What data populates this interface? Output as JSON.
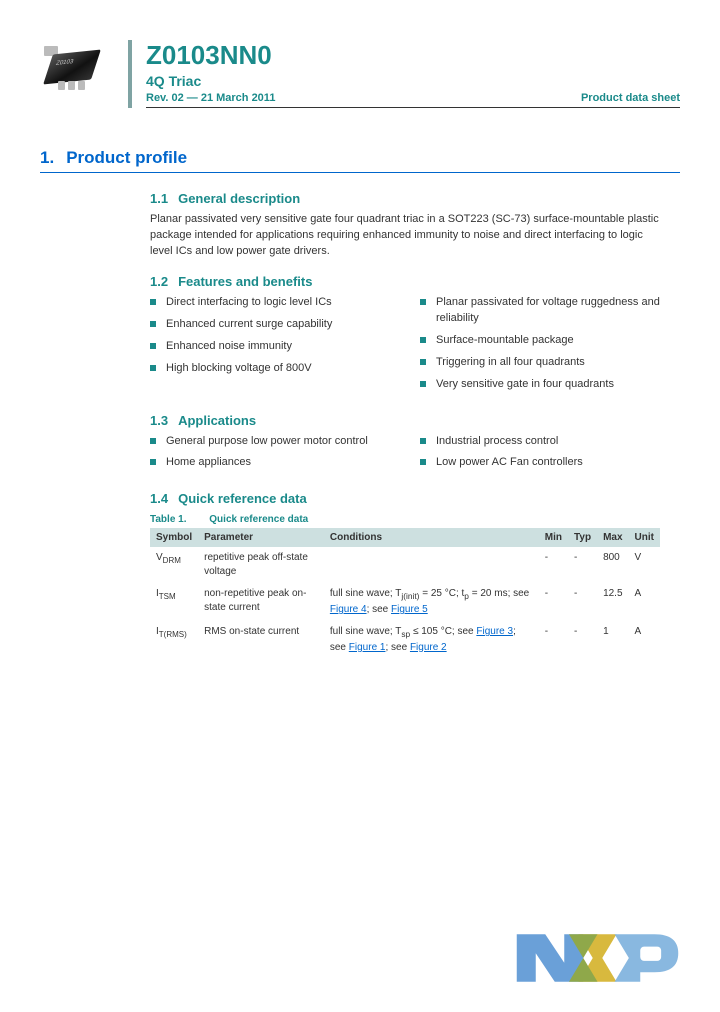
{
  "header": {
    "part_number": "Z0103NN0",
    "subtitle": "4Q Triac",
    "revision": "Rev. 02 — 21 March 2011",
    "doc_type": "Product data sheet"
  },
  "section1": {
    "num": "1.",
    "title": "Product profile"
  },
  "s11": {
    "num": "1.1",
    "title": "General description",
    "body": "Planar passivated very sensitive gate four quadrant triac in a SOT223 (SC-73) surface-mountable plastic package intended for applications requiring enhanced immunity to noise and direct interfacing to logic level ICs and low power gate drivers."
  },
  "s12": {
    "num": "1.2",
    "title": "Features and benefits",
    "left": [
      "Direct interfacing to logic level ICs",
      "Enhanced current surge capability",
      "Enhanced noise immunity",
      "High blocking voltage of 800V"
    ],
    "right": [
      "Planar passivated for voltage ruggedness and reliability",
      "Surface-mountable package",
      "Triggering in all four quadrants",
      "Very sensitive gate in four quadrants"
    ]
  },
  "s13": {
    "num": "1.3",
    "title": "Applications",
    "left": [
      "General purpose low power motor control",
      "Home appliances"
    ],
    "right": [
      "Industrial process control",
      "Low power AC Fan controllers"
    ]
  },
  "s14": {
    "num": "1.4",
    "title": "Quick reference data",
    "table_label": "Table 1.",
    "table_caption": "Quick reference data",
    "cols": {
      "symbol": "Symbol",
      "parameter": "Parameter",
      "conditions": "Conditions",
      "min": "Min",
      "typ": "Typ",
      "max": "Max",
      "unit": "Unit"
    },
    "rows": [
      {
        "sym_html": "V<sub>DRM</sub>",
        "param": "repetitive peak off-state voltage",
        "cond_html": "",
        "min": "-",
        "typ": "-",
        "max": "800",
        "unit": "V"
      },
      {
        "sym_html": "I<sub>TSM</sub>",
        "param": "non-repetitive peak on-state current",
        "cond_html": "full sine wave; T<sub>j(init)</sub> = 25 °C; t<sub>p</sub> = 20 ms; see <span class='figlink'>Figure 4</span>; see <span class='figlink'>Figure 5</span>",
        "min": "-",
        "typ": "-",
        "max": "12.5",
        "unit": "A"
      },
      {
        "sym_html": "I<sub>T(RMS)</sub>",
        "param": "RMS on-state current",
        "cond_html": "full sine wave; T<sub>sp</sub> ≤ 105 °C; see <span class='figlink'>Figure 3</span>; see <span class='figlink'>Figure 1</span>; see <span class='figlink'>Figure 2</span>",
        "min": "-",
        "typ": "-",
        "max": "1",
        "unit": "A"
      }
    ]
  }
}
